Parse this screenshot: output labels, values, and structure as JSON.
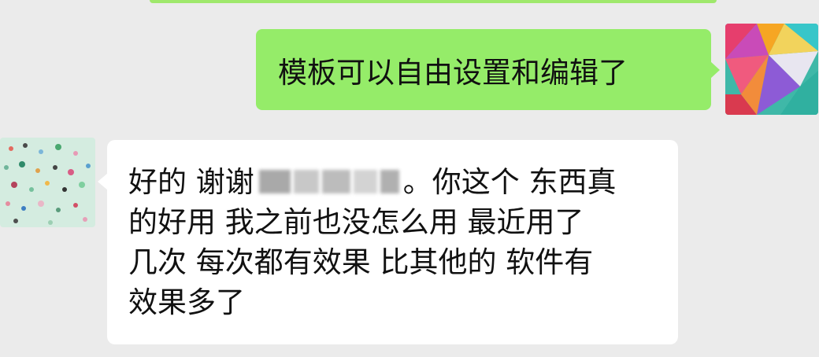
{
  "chat": {
    "outgoing": {
      "text": "模板可以自由设置和编辑了",
      "bubble_color": "#95ec69"
    },
    "incoming": {
      "line1_before": "好的 谢谢",
      "line1_after": "。你这个 东西真",
      "line2": "的好用 我之前也没怎么用 最近用了",
      "line3": "几次 每次都有效果 比其他的 软件有",
      "line4": "效果多了",
      "bubble_color": "#ffffff"
    }
  },
  "colors": {
    "background": "#ebebeb",
    "accent": "#9fe86c"
  }
}
